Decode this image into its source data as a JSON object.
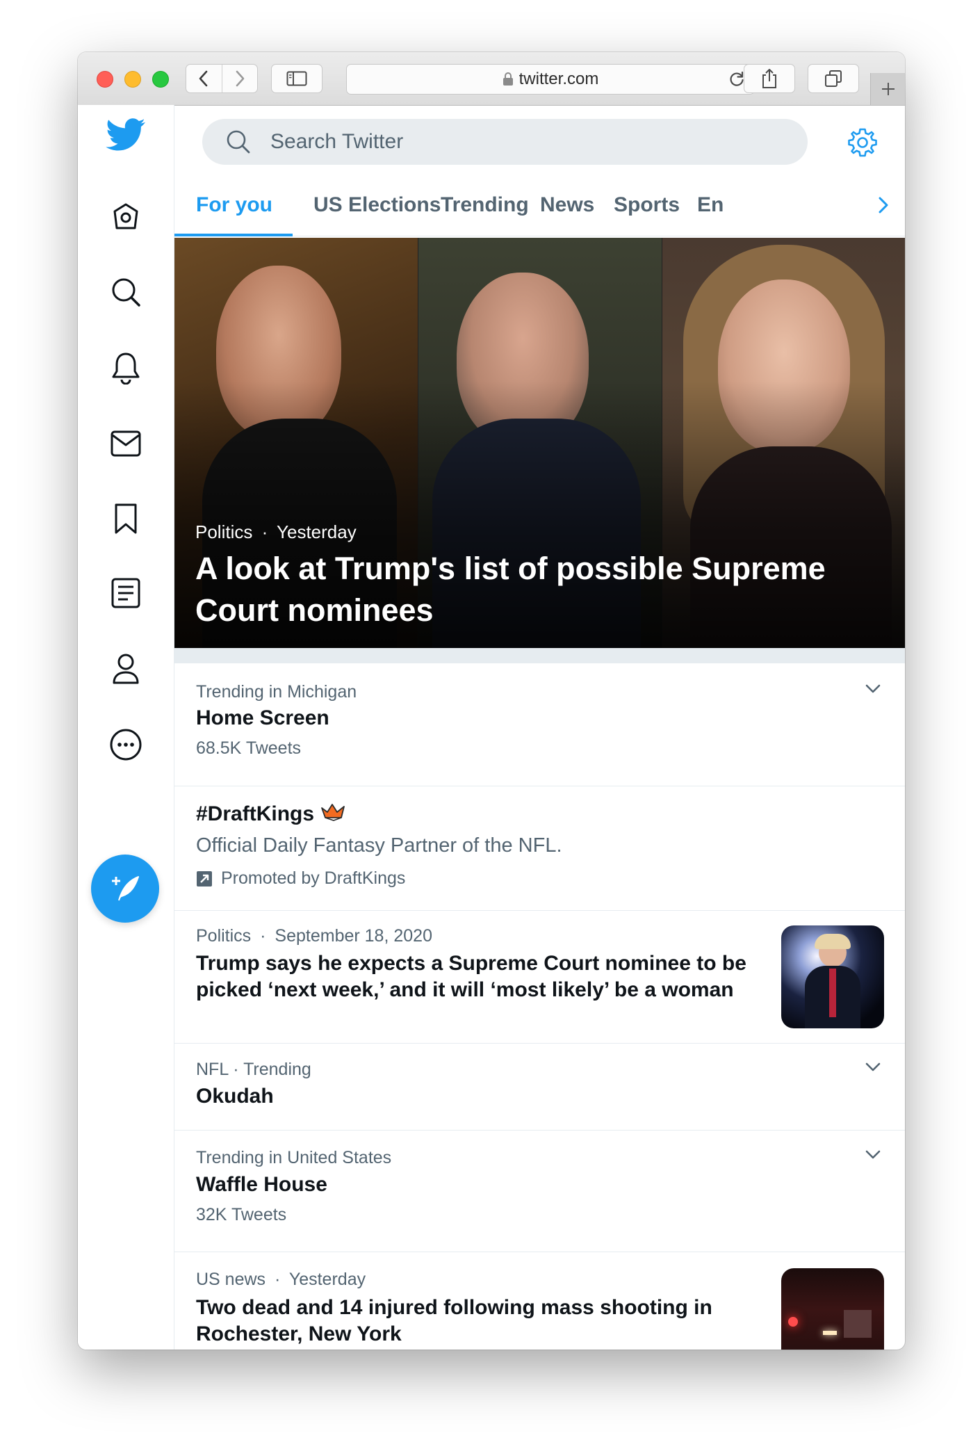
{
  "browser": {
    "url": "twitter.com"
  },
  "search": {
    "placeholder": "Search Twitter"
  },
  "tabs": [
    {
      "label": "For you"
    },
    {
      "label": "US Elections"
    },
    {
      "label": "Trending"
    },
    {
      "label": "News"
    },
    {
      "label": "Sports"
    },
    {
      "label": "En"
    }
  ],
  "hero": {
    "category": "Politics",
    "separator": "·",
    "time": "Yesterday",
    "title": "A look at Trump's list of possible Supreme Court nominees"
  },
  "feed": {
    "trend1": {
      "context": "Trending in Michigan",
      "title": "Home Screen",
      "count": "68.5K Tweets"
    },
    "promo": {
      "title": "#DraftKings",
      "description": "Official Daily Fantasy Partner of the NFL.",
      "promoted": "Promoted by DraftKings"
    },
    "news1": {
      "category": "Politics",
      "separator": "·",
      "date": "September 18, 2020",
      "title": "Trump says he expects a Supreme Court nominee to be picked ‘next week,’ and it will ‘most likely’ be a woman"
    },
    "trend2": {
      "context": "NFL · Trending",
      "title": "Okudah"
    },
    "trend3": {
      "context": "Trending in United States",
      "title": "Waffle House",
      "count": "32K Tweets"
    },
    "news2": {
      "category": "US news",
      "separator": "·",
      "date": "Yesterday",
      "title": "Two dead and 14 injured following mass shooting in Rochester, New York"
    }
  },
  "colors": {
    "accent": "#1d9bf0",
    "text_primary": "#0f1419",
    "text_secondary": "#536471",
    "divider": "#e6ecf0"
  },
  "icons": {
    "nav": [
      "twitter-logo-icon",
      "home-icon",
      "explore-search-icon",
      "notifications-bell-icon",
      "messages-mail-icon",
      "bookmarks-icon",
      "lists-icon",
      "profile-icon",
      "more-icon",
      "compose-tweet-icon"
    ]
  }
}
